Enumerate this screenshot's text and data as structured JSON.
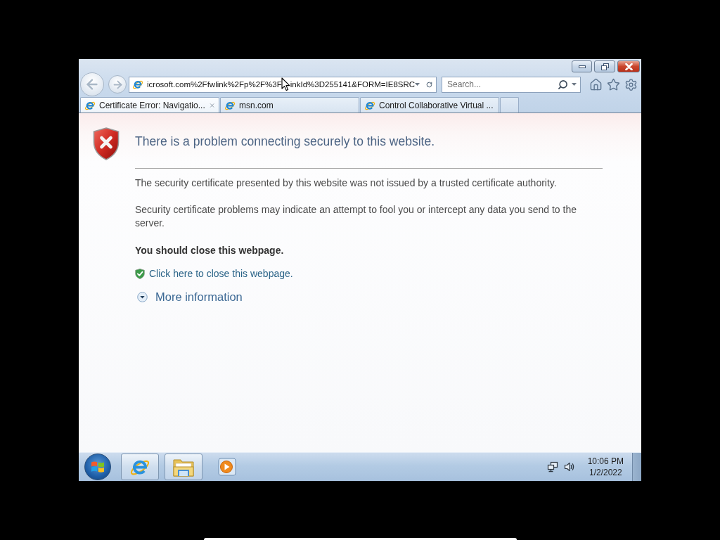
{
  "navigation": {
    "back": {
      "disabled": true
    },
    "forward": {
      "disabled": true
    }
  },
  "address_bar": {
    "url_segments": [
      "icrosoft.com%2Ffwlink%2Fp%2F%3F",
      "inkId%3D255141&FORM=IE8SRC"
    ]
  },
  "search": {
    "placeholder": "Search..."
  },
  "tabs": [
    {
      "label": "Certificate Error: Navigatio...",
      "selected": true
    },
    {
      "label": "msn.com",
      "selected": false
    },
    {
      "label": "Control Collaborative Virtual ...",
      "selected": false
    }
  ],
  "page": {
    "title": "There is a problem connecting securely to this website.",
    "paragraphs": [
      "The security certificate presented by this website was not issued by a trusted certificate authority.",
      "Security certificate problems may indicate an attempt to fool you or intercept any data you send to the server."
    ],
    "recommendation": "You should close this webpage.",
    "close_link": "Click here to close this webpage.",
    "more_info": {
      "label": "More information",
      "expanded": false
    }
  },
  "taskbar": {
    "apps": [
      {
        "kind": "browser",
        "running": true
      },
      {
        "kind": "files",
        "running": true
      },
      {
        "kind": "media",
        "running": false
      }
    ],
    "clock": {
      "time": "10:06 PM",
      "date": "1/2/2022"
    }
  }
}
